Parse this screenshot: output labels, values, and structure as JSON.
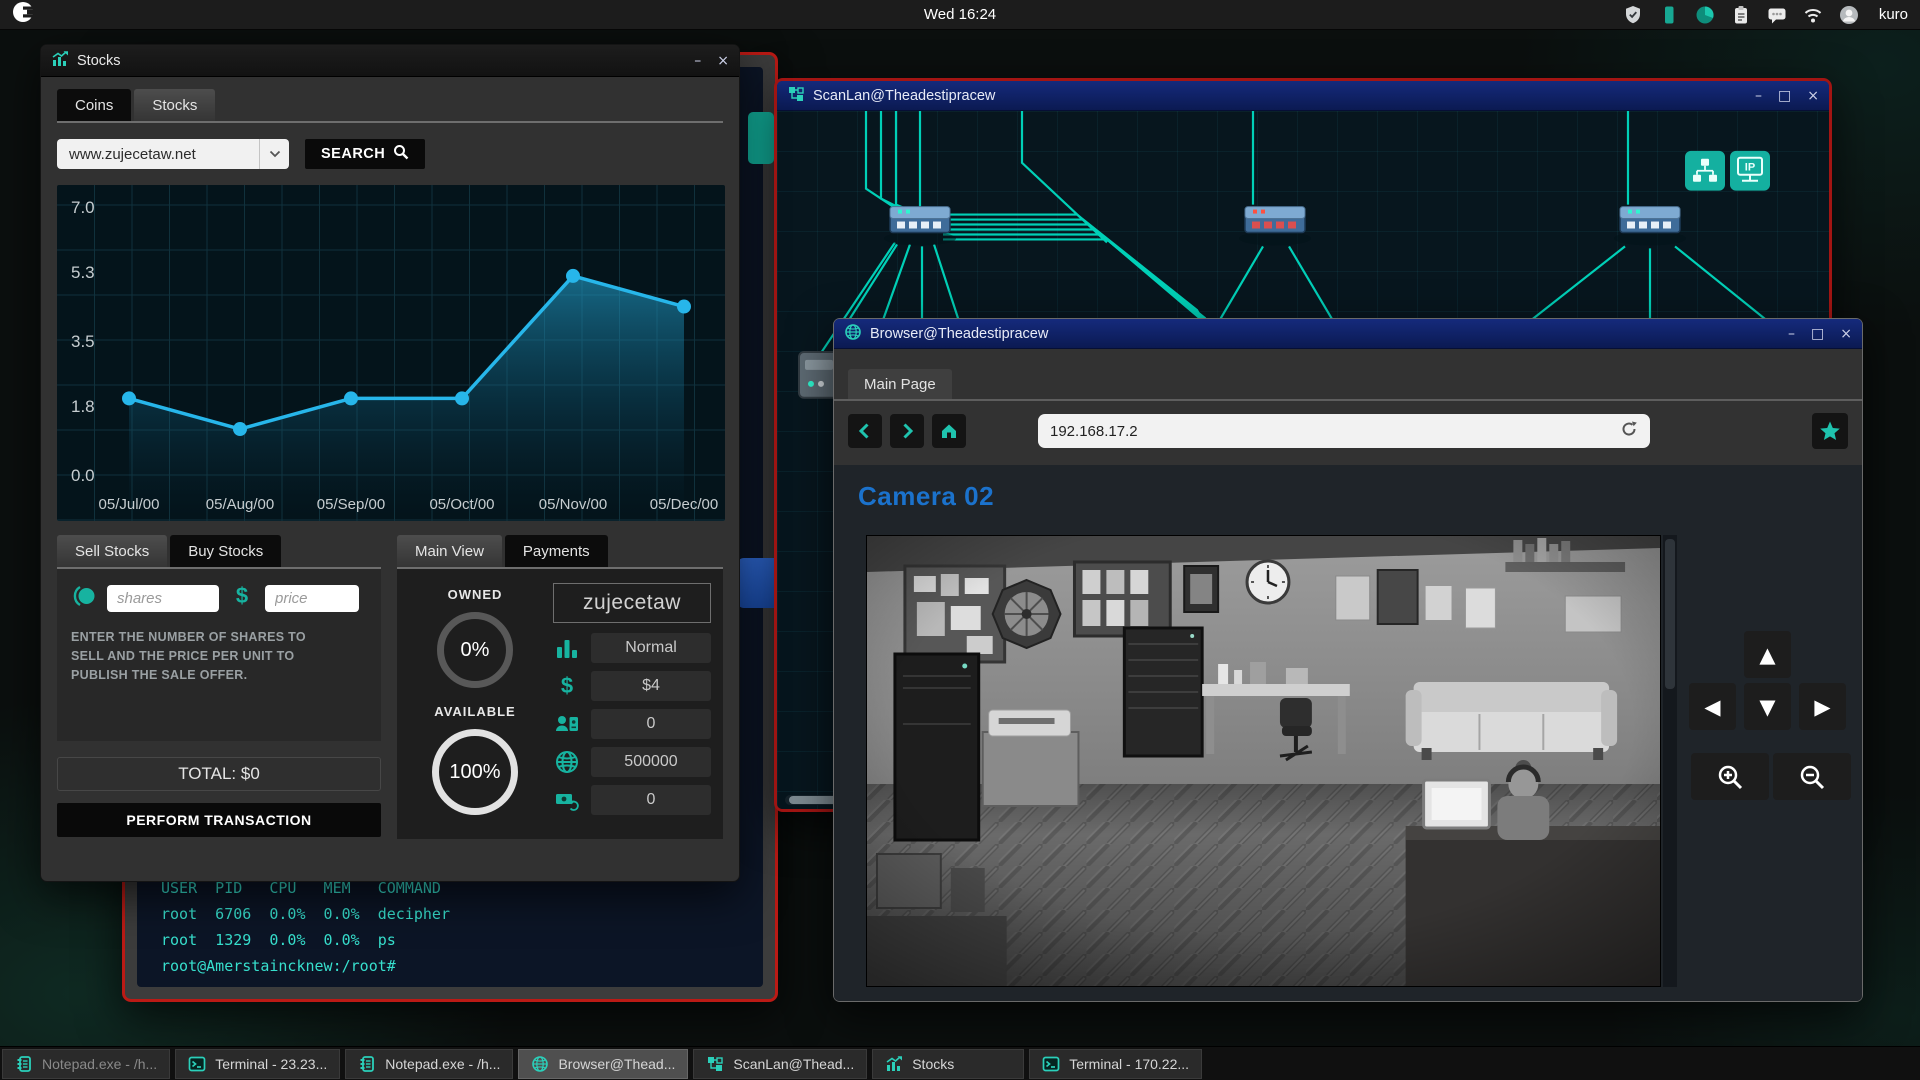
{
  "topbar": {
    "clock": "Wed 16:24",
    "username": "kuro",
    "status_icons": [
      "shield-icon",
      "battery-icon",
      "disk-pie-icon",
      "clipboard-icon",
      "chat-icon",
      "wifi-icon",
      "avatar-icon"
    ]
  },
  "window_controls": {
    "minimize": "–",
    "maximize": "□",
    "close": "×"
  },
  "stocks_window": {
    "title": "Stocks",
    "tabs": [
      {
        "label": "Coins",
        "active": false
      },
      {
        "label": "Stocks",
        "active": true
      }
    ],
    "search": {
      "value": "www.zujecetaw.net",
      "button_label": "SEARCH"
    },
    "chart_data": {
      "type": "line",
      "x": [
        "05/Jul/00",
        "05/Aug/00",
        "05/Sep/00",
        "05/Oct/00",
        "05/Nov/00",
        "05/Dec/00"
      ],
      "values": [
        2.0,
        1.2,
        2.0,
        2.0,
        5.2,
        4.4
      ],
      "yticks": [
        7.0,
        5.3,
        3.5,
        1.8,
        0.0
      ],
      "ylim": [
        0,
        7.8
      ],
      "grid": true,
      "line_color": "#27b6ea",
      "title": "",
      "xlabel": "",
      "ylabel": ""
    },
    "trade": {
      "tabs": [
        {
          "label": "Sell Stocks",
          "active": true
        },
        {
          "label": "Buy Stocks",
          "active": false
        }
      ],
      "shares_placeholder": "shares",
      "price_placeholder": "price",
      "help_text": "ENTER THE NUMBER OF SHARES TO SELL AND THE PRICE PER UNIT TO PUBLISH THE SALE OFFER.",
      "total_label": "TOTAL: $0",
      "submit_label": "PERFORM TRANSACTION"
    },
    "overview": {
      "tabs": [
        {
          "label": "Main View",
          "active": true
        },
        {
          "label": "Payments",
          "active": false
        }
      ],
      "owned_label": "OWNED",
      "owned_value": "0%",
      "available_label": "AVAILABLE",
      "available_value": "100%",
      "stock_name": "zujecetaw",
      "rows": [
        {
          "icon": "bar-chart-icon",
          "value": "Normal"
        },
        {
          "icon": "dollar-icon",
          "value": "$4"
        },
        {
          "icon": "shareholders-icon",
          "value": "0"
        },
        {
          "icon": "globe-icon",
          "value": "500000"
        },
        {
          "icon": "money-sync-icon",
          "value": "0"
        }
      ]
    }
  },
  "terminal_window": {
    "lines": [
      "USER  PID   CPU   MEM   COMMAND",
      "root  6706  0.0%  0.0%  decipher",
      "root  1329  0.0%  0.0%  ps",
      "root@Amerstaincknew:/root#"
    ]
  },
  "scanlan_window": {
    "title": "ScanLan@Theadestipracew",
    "toolbar_icons": [
      "lan-tree-icon",
      "ip-monitor-icon"
    ]
  },
  "browser_window": {
    "title": "Browser@Theadestipracew",
    "tab_label": "Main Page",
    "url": "192.168.17.2",
    "page_heading": "Camera 02"
  },
  "taskbar": {
    "items": [
      {
        "icon": "notepad-icon",
        "label": "Notepad.exe - /h...",
        "dim": true
      },
      {
        "icon": "terminal-icon",
        "label": "Terminal - 23.23..."
      },
      {
        "icon": "notepad-icon",
        "label": "Notepad.exe - /h..."
      },
      {
        "icon": "browser-icon",
        "label": "Browser@Thead...",
        "active": true
      },
      {
        "icon": "scanlan-icon",
        "label": "ScanLan@Thead..."
      },
      {
        "icon": "stocks-icon",
        "label": "Stocks"
      },
      {
        "icon": "terminal-icon",
        "label": "Terminal - 170.22..."
      }
    ]
  },
  "colors": {
    "accent_teal": "#17b3a0",
    "titlebar_blue": "#12266e",
    "alert_red": "#b01815",
    "chart_line": "#27b6ea",
    "camera_heading_blue": "#1b72cc",
    "terminal_text": "#37dfcd"
  }
}
